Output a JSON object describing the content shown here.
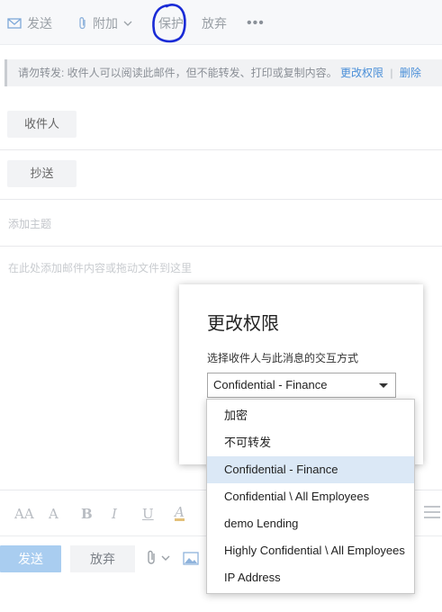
{
  "toolbar": {
    "send_label": "发送",
    "attach_label": "附加",
    "protect_label": "保护",
    "discard_label": "放弃",
    "more_label": "•••"
  },
  "infobar": {
    "message": "请勿转发: 收件人可以阅读此邮件，但不能转发、打印或复制内容。",
    "change_permissions_link": "更改权限",
    "separator": "|",
    "remove_link": "删除"
  },
  "fields": {
    "to_label": "收件人",
    "cc_label": "抄送",
    "subject_placeholder": "添加主题",
    "body_placeholder": "在此处添加邮件内容或拖动文件到这里"
  },
  "format_bar": {
    "items": [
      "AA",
      "A",
      "B",
      "I",
      "U",
      "A"
    ]
  },
  "bottom": {
    "send_label": "发送",
    "discard_label": "放弃"
  },
  "dialog": {
    "title": "更改权限",
    "label": "选择收件人与此消息的交互方式",
    "selected_value": "Confidential - Finance"
  },
  "dropdown": {
    "options": [
      "加密",
      "不可转发",
      "Confidential - Finance",
      "Confidential \\ All Employees",
      "demo Lending",
      "Highly Confidential \\ All Employees",
      "IP Address"
    ],
    "selected_index": 2
  },
  "colors": {
    "accent_link": "#4a8fd8",
    "send_button": "#a9cdf0",
    "selected_option": "#dbe8f6",
    "annotation_circle": "#1a2bd6"
  },
  "icons": [
    "mail-icon",
    "paperclip-icon",
    "chevron-down-icon",
    "image-icon"
  ]
}
